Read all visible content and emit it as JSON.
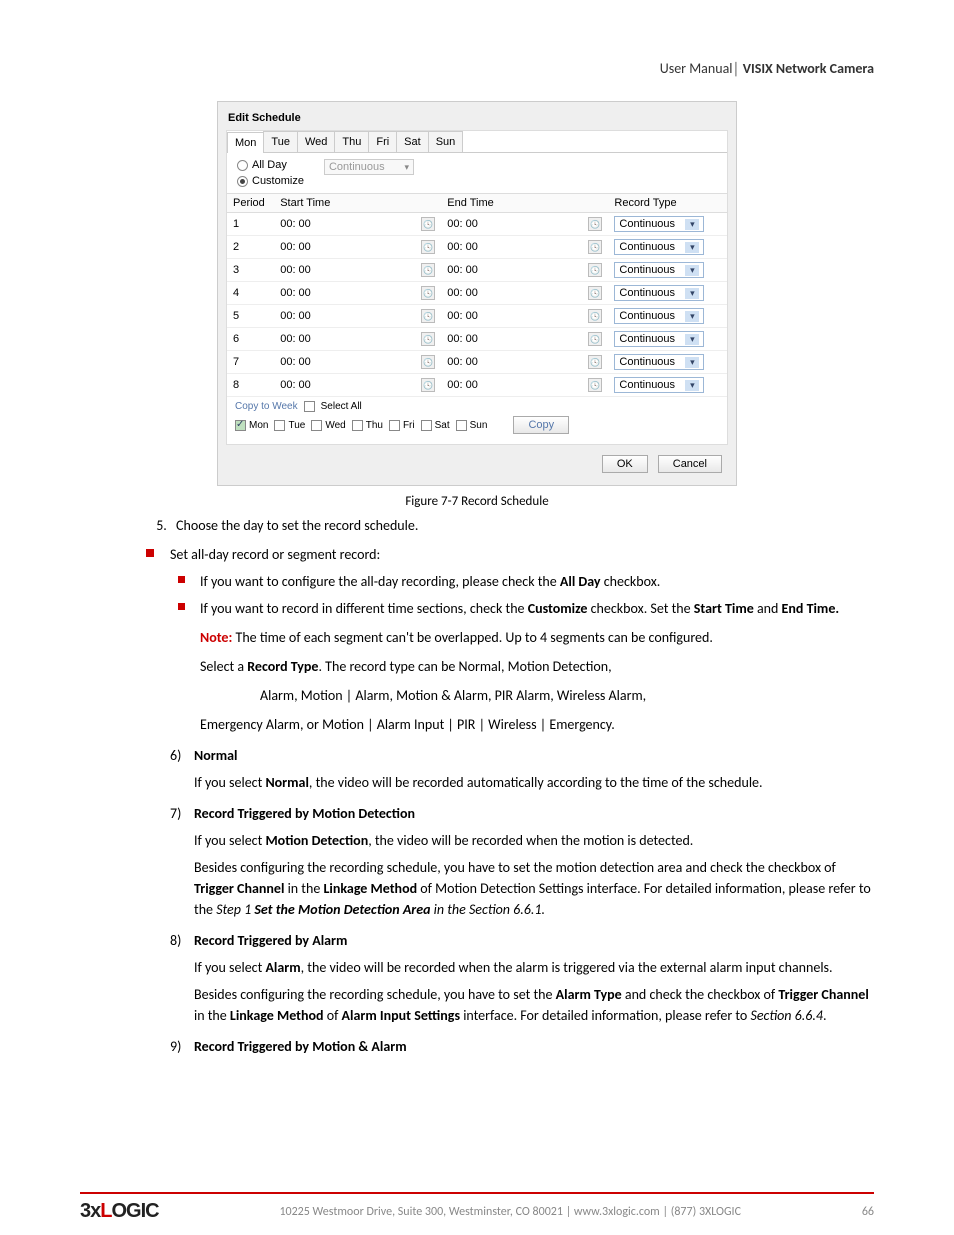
{
  "header": {
    "left": "User Manual",
    "right": "VISIX Network Camera"
  },
  "dialog": {
    "title": "Edit Schedule",
    "tabs": [
      "Mon",
      "Tue",
      "Wed",
      "Thu",
      "Fri",
      "Sat",
      "Sun"
    ],
    "active_tab": "Mon",
    "radio": {
      "all_day": "All Day",
      "customize": "Customize",
      "selected": "customize",
      "preset": "Continuous"
    },
    "columns": {
      "period": "Period",
      "start": "Start Time",
      "end": "End Time",
      "type": "Record Type"
    },
    "rows": [
      {
        "period": "1",
        "start": "00: 00",
        "end": "00: 00",
        "type": "Continuous"
      },
      {
        "period": "2",
        "start": "00: 00",
        "end": "00: 00",
        "type": "Continuous"
      },
      {
        "period": "3",
        "start": "00: 00",
        "end": "00: 00",
        "type": "Continuous"
      },
      {
        "period": "4",
        "start": "00: 00",
        "end": "00: 00",
        "type": "Continuous"
      },
      {
        "period": "5",
        "start": "00: 00",
        "end": "00: 00",
        "type": "Continuous"
      },
      {
        "period": "6",
        "start": "00: 00",
        "end": "00: 00",
        "type": "Continuous"
      },
      {
        "period": "7",
        "start": "00: 00",
        "end": "00: 00",
        "type": "Continuous"
      },
      {
        "period": "8",
        "start": "00: 00",
        "end": "00: 00",
        "type": "Continuous"
      }
    ],
    "copy": {
      "label": "Copy to Week",
      "select_all": "Select All",
      "days": [
        {
          "label": "Mon",
          "checked": true
        },
        {
          "label": "Tue",
          "checked": false
        },
        {
          "label": "Wed",
          "checked": false
        },
        {
          "label": "Thu",
          "checked": false
        },
        {
          "label": "Fri",
          "checked": false
        },
        {
          "label": "Sat",
          "checked": false
        },
        {
          "label": "Sun",
          "checked": false
        }
      ],
      "copy_btn": "Copy"
    },
    "buttons": {
      "ok": "OK",
      "cancel": "Cancel"
    }
  },
  "caption": {
    "fig": "Figure 7-7",
    "text": "Record Schedule"
  },
  "step5": "Choose the day to set the record schedule.",
  "line_setallday": "Set all-day record or segment record:",
  "bullet_allday_a": "If you want to configure the all-day recording, please check the ",
  "bullet_allday_b": "All Day",
  "bullet_allday_c": " checkbox.",
  "bullet_cust_a": "If you want to record in different time sections, check the ",
  "bullet_cust_b": "Customize",
  "bullet_cust_c": " checkbox. Set the ",
  "bullet_cust_d": "Start Time",
  "bullet_cust_e": " and ",
  "bullet_cust_f": "End Time.",
  "note_label": "Note:",
  "note_text": " The time of each segment can't be overlapped. Up to 4 segments can be configured.",
  "select_rt_a": "Select a ",
  "select_rt_b": "Record Type",
  "select_rt_c": ". The record type can be Normal, Motion Detection,",
  "rt_line2": "Alarm, Motion | Alarm, Motion & Alarm, PIR Alarm, Wireless Alarm,",
  "rt_line3": "Emergency Alarm, or Motion | Alarm Input | PIR | Wireless | Emergency.",
  "s6num": "6)",
  "s6h": "Normal",
  "s6a": "If you select ",
  "s6b": "Normal",
  "s6c": ", the video will be recorded automatically according to the time of the schedule.",
  "s7num": "7)",
  "s7h": "Record Triggered by Motion Detection",
  "s7a": "If you select ",
  "s7b": "Motion Detection",
  "s7c": ", the video will be recorded when the motion is detected.",
  "s7d1": "Besides configuring the recording schedule, you have to set the motion detection area and check the checkbox of ",
  "s7d2": "Trigger Channel",
  "s7d3": " in the ",
  "s7d4": "Linkage Method",
  "s7d5": " of Motion Detection Settings interface. For detailed information, please refer to the ",
  "s7d6": "Step 1 ",
  "s7d7": "Set the Motion Detection Area",
  "s7d8": " in the Section 6.6.1.",
  "s8num": "8)",
  "s8h": "Record Triggered by Alarm",
  "s8a": "If you select ",
  "s8b": "Alarm",
  "s8c": ", the video will be recorded when the alarm is triggered via the external alarm input channels.",
  "s8d1": "Besides configuring the recording schedule, you have to set the ",
  "s8d2": "Alarm Type",
  "s8d3": " and check the checkbox of ",
  "s8d4": "Trigger Channel",
  "s8d5": " in the ",
  "s8d6": "Linkage Method",
  "s8d7": " of ",
  "s8d8": "Alarm Input Settings",
  "s8d9": " interface. For detailed information, please refer to ",
  "s8d10": "Section 6.6.4",
  "s8d11": ".",
  "s9num": "9)",
  "s9h": "Record Triggered by Motion & Alarm",
  "footer": {
    "addr": "10225 Westmoor Drive, Suite 300, Westminster, CO 80021 | www.3xlogic.com | (877) 3XLOGIC",
    "page": "66",
    "logo_a": "3x",
    "logo_b": "LOGIC"
  }
}
